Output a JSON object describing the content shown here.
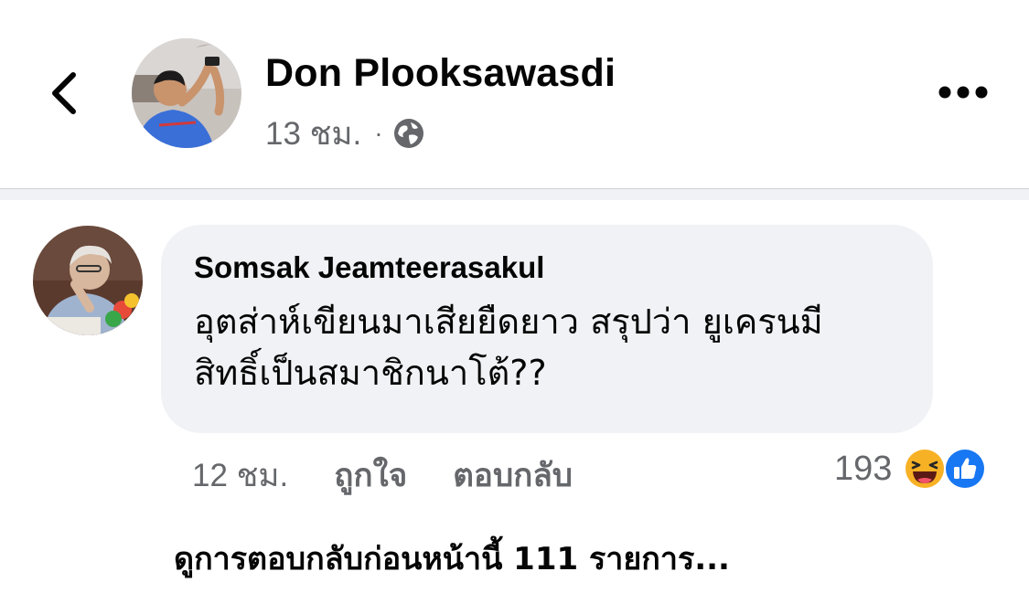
{
  "post": {
    "author": "Don Plooksawasdi",
    "time": "13 ชม.",
    "separator": "·",
    "privacy_icon": "globe-icon"
  },
  "header": {
    "back_icon": "chevron-left-icon",
    "more_icon": "more-horizontal-icon"
  },
  "comment": {
    "author": "Somsak Jeamteerasakul",
    "text_line1": "อุตส่าห์เขียนมาเสียยืดยาว สรุปว่า ยูเครนมี",
    "text_line2": "สิทธิ์เป็นสมาชิกนาโต้??",
    "time": "12 ชม.",
    "like_label": "ถูกใจ",
    "reply_label": "ตอบกลับ",
    "reaction_count": "193",
    "reactions": [
      "haha-icon",
      "like-icon"
    ]
  },
  "view_previous": "ดูการตอบกลับก่อนหน้านี้ 111 รายการ...",
  "colors": {
    "bubble": "#f0f2f5",
    "secondary_text": "#65676b",
    "like_blue": "#1877f2",
    "haha_yellow": "#f7b125"
  }
}
